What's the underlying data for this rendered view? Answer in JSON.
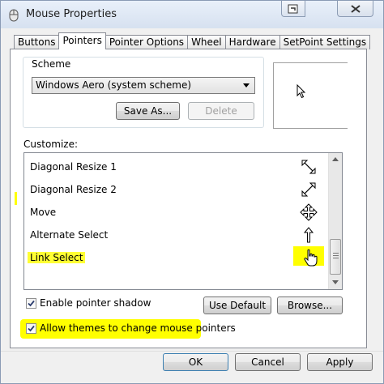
{
  "window": {
    "title": "Mouse Properties"
  },
  "tabs": [
    {
      "label": "Buttons",
      "active": false
    },
    {
      "label": "Pointers",
      "active": true
    },
    {
      "label": "Pointer Options",
      "active": false
    },
    {
      "label": "Wheel",
      "active": false
    },
    {
      "label": "Hardware",
      "active": false
    },
    {
      "label": "SetPoint Settings",
      "active": false
    }
  ],
  "scheme": {
    "label": "Scheme",
    "selected": "Windows Aero (system scheme)",
    "save_as_label": "Save As...",
    "delete_label": "Delete"
  },
  "customize": {
    "label": "Customize:",
    "items": [
      {
        "label": "Diagonal Resize 1",
        "icon": "diagonal-resize-1-icon"
      },
      {
        "label": "Diagonal Resize 2",
        "icon": "diagonal-resize-2-icon"
      },
      {
        "label": "Move",
        "icon": "move-icon"
      },
      {
        "label": "Alternate Select",
        "icon": "alternate-select-icon"
      },
      {
        "label": "Link Select",
        "icon": "hand-pointer-icon",
        "highlighted": true
      }
    ]
  },
  "options": {
    "enable_shadow_label": "Enable pointer shadow",
    "enable_shadow_checked": true,
    "use_default_label": "Use Default",
    "browse_label": "Browse...",
    "allow_themes_label": "Allow themes to change mouse pointers",
    "allow_themes_checked": true
  },
  "footer": {
    "ok_label": "OK",
    "cancel_label": "Cancel",
    "apply_label": "Apply"
  },
  "colors": {
    "highlight": "#ffff00",
    "window_bg": "#f0f0f0",
    "panel_bg": "#ffffff"
  }
}
